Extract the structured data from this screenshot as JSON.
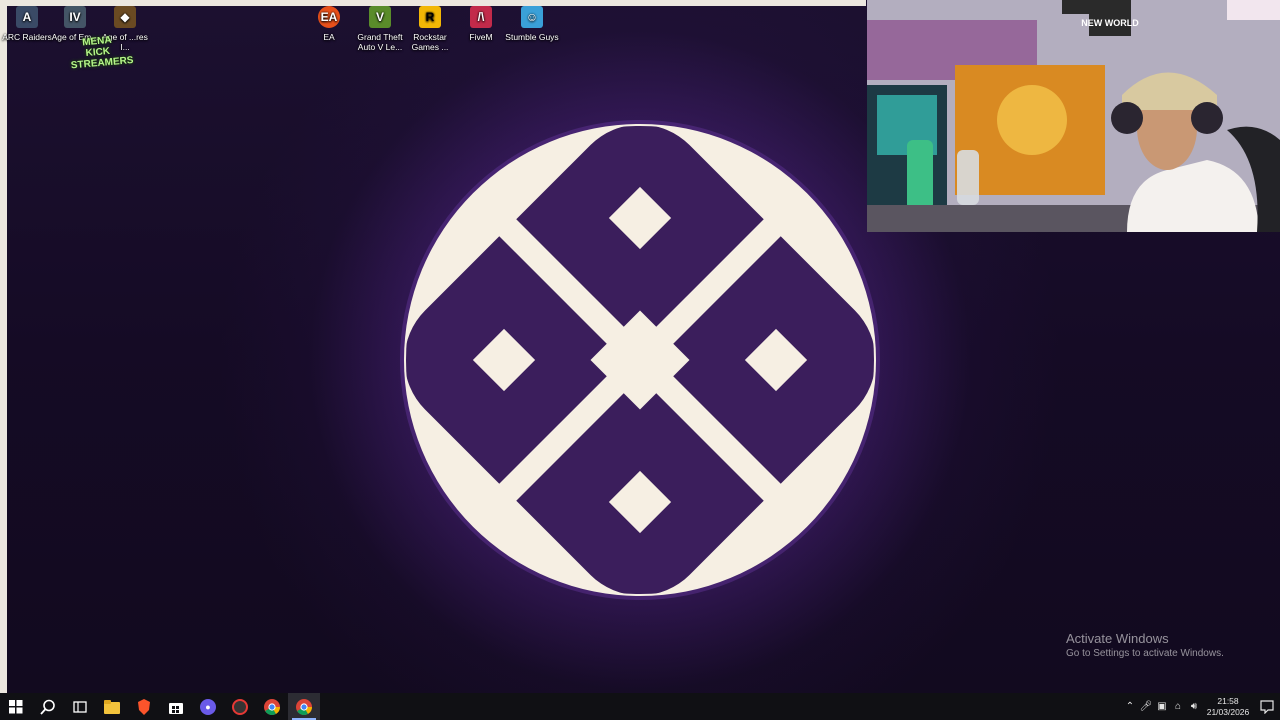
{
  "desktop": {
    "icons": [
      {
        "label": "ARC Raiders",
        "icon": "arc-raiders-icon",
        "color": "#3a4a66"
      },
      {
        "label": "Age of Em...",
        "icon": "age-of-empires-iv-icon",
        "color": "#445566"
      },
      {
        "label": "Age of ...res I...",
        "icon": "age-of-empires-icon",
        "color": "#6a4a22"
      },
      {
        "label": "EA",
        "icon": "ea-icon",
        "color": "#e8501a"
      },
      {
        "label": "Grand Theft Auto V Le...",
        "icon": "gta-v-icon",
        "color": "#5a8c2a"
      },
      {
        "label": "Rockstar Games ...",
        "icon": "rockstar-games-icon",
        "color": "#f2b705"
      },
      {
        "label": "FiveM",
        "icon": "fivem-icon",
        "color": "#c22a4a"
      },
      {
        "label": "Stumble Guys",
        "icon": "stumble-guys-icon",
        "color": "#3aa0d8"
      }
    ],
    "overlay_badge": "MENA KICK STREAMERS",
    "wallpaper_logo": "circle-x-logo",
    "watermark": {
      "title": "Activate Windows",
      "subtitle": "Go to Settings to activate Windows."
    }
  },
  "webcam": {
    "poster_text": "NEW WORLD",
    "label": "webcam-feed"
  },
  "taskbar": {
    "items": [
      {
        "icon": "windows-start-icon",
        "color": "#ffffff"
      },
      {
        "icon": "search-icon",
        "color": "#ffffff"
      },
      {
        "icon": "task-view-icon",
        "color": "#ffffff"
      },
      {
        "icon": "file-explorer-icon",
        "color": "#f3c33c"
      },
      {
        "icon": "brave-browser-icon",
        "color": "#fb542b"
      },
      {
        "icon": "microsoft-store-icon",
        "color": "#ffffff"
      },
      {
        "icon": "obs-icon",
        "color": "#6a5ae8"
      },
      {
        "icon": "screen-recorder-icon",
        "color": "#e53935"
      },
      {
        "icon": "chrome-icon",
        "color": "#34a853"
      },
      {
        "icon": "chrome-active-icon",
        "color": "#34a853"
      }
    ],
    "tray": {
      "time": "21:58",
      "date": "21/03/2026"
    }
  },
  "colors": {
    "logo_purple": "#3b1e5c",
    "logo_cream": "#f6efe3",
    "glow": "#8c5ad8"
  }
}
